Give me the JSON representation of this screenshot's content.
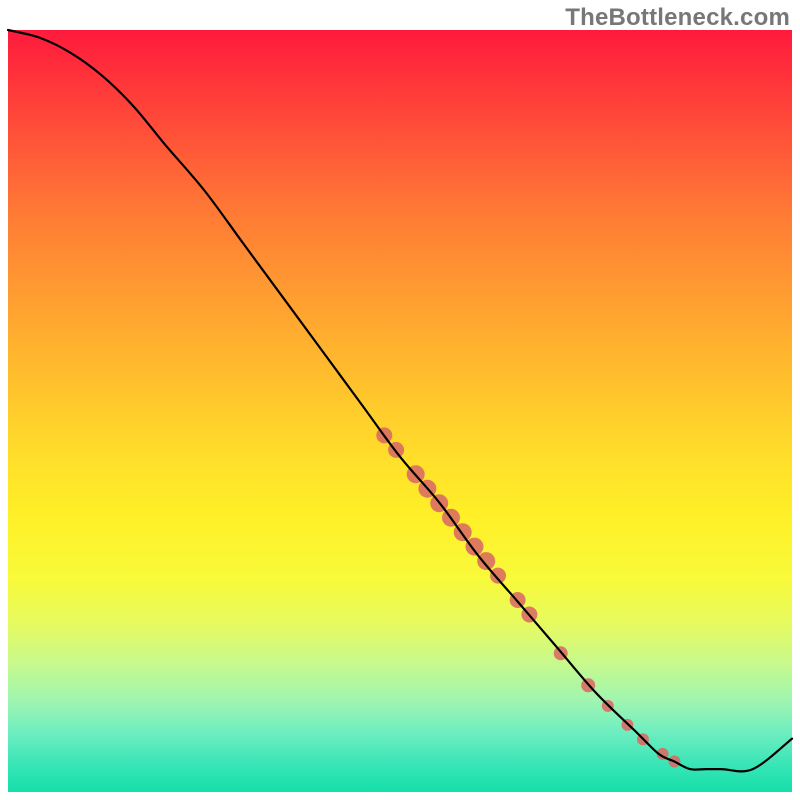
{
  "watermark": "TheBottleneck.com",
  "chart_data": {
    "type": "line",
    "title": "",
    "xlabel": "",
    "ylabel": "",
    "xlim": [
      0,
      100
    ],
    "ylim": [
      0,
      100
    ],
    "grid": false,
    "series": [
      {
        "name": "curve",
        "x": [
          0,
          4,
          8,
          12,
          16,
          20,
          25,
          30,
          35,
          40,
          45,
          50,
          55,
          60,
          65,
          70,
          75,
          80,
          83,
          85,
          87,
          89,
          91,
          95,
          100
        ],
        "y": [
          100,
          99,
          97,
          94,
          90,
          85,
          79,
          72,
          65,
          58,
          51,
          44,
          38,
          31,
          25,
          19,
          13,
          8,
          5,
          4,
          3,
          3,
          3,
          3,
          7
        ]
      }
    ],
    "markers": {
      "name": "highlighted-points",
      "color": "#d96a62",
      "points": [
        {
          "x": 48.0,
          "y": 46.8,
          "r": 8
        },
        {
          "x": 49.5,
          "y": 44.9,
          "r": 8
        },
        {
          "x": 52.0,
          "y": 41.7,
          "r": 9
        },
        {
          "x": 53.5,
          "y": 39.8,
          "r": 9
        },
        {
          "x": 55.0,
          "y": 37.9,
          "r": 9
        },
        {
          "x": 56.5,
          "y": 36.0,
          "r": 9
        },
        {
          "x": 58.0,
          "y": 34.1,
          "r": 9
        },
        {
          "x": 59.5,
          "y": 32.2,
          "r": 9
        },
        {
          "x": 61.0,
          "y": 30.3,
          "r": 9
        },
        {
          "x": 62.5,
          "y": 28.4,
          "r": 8
        },
        {
          "x": 65.0,
          "y": 25.2,
          "r": 8
        },
        {
          "x": 66.5,
          "y": 23.3,
          "r": 8
        },
        {
          "x": 70.5,
          "y": 18.2,
          "r": 7
        },
        {
          "x": 74.0,
          "y": 14.0,
          "r": 7
        },
        {
          "x": 76.5,
          "y": 11.3,
          "r": 6
        },
        {
          "x": 79.0,
          "y": 8.8,
          "r": 6
        },
        {
          "x": 81.0,
          "y": 6.9,
          "r": 6
        },
        {
          "x": 83.5,
          "y": 5.0,
          "r": 6
        },
        {
          "x": 85.0,
          "y": 4.0,
          "r": 6
        }
      ]
    }
  }
}
